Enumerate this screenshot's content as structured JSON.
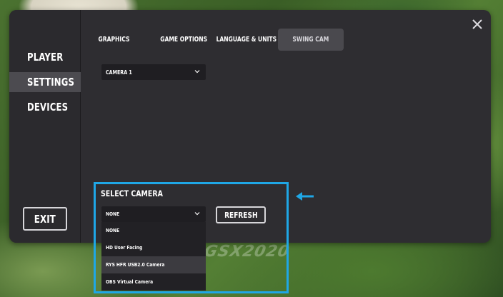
{
  "watermark": "GSX2020",
  "sidebar": {
    "items": [
      {
        "label": "PLAYER"
      },
      {
        "label": "SETTINGS"
      },
      {
        "label": "DEVICES"
      }
    ],
    "exit_label": "EXIT"
  },
  "tabs": [
    {
      "label": "GRAPHICS"
    },
    {
      "label": "GAME OPTIONS"
    },
    {
      "label": "LANGUAGE & UNITS"
    },
    {
      "label": "SWING CAM"
    }
  ],
  "active_tab": "SWING CAM",
  "camera_dropdown": {
    "value": "CAMERA 1"
  },
  "select_camera": {
    "title": "SELECT CAMERA",
    "selected": "NONE",
    "refresh_label": "REFRESH",
    "options": [
      {
        "label": "NONE"
      },
      {
        "label": "HD User Facing"
      },
      {
        "label": "RYS HFR USB2.0 Camera"
      },
      {
        "label": "OBS Virtual Camera"
      }
    ]
  },
  "colors": {
    "panel": "#2e2d31",
    "active_tab": "#4a494e",
    "highlight": "#1fa7e6",
    "active_nav": "#4c4b50"
  },
  "icons": {
    "close": "close-icon",
    "chevron": "chevron-down-icon",
    "arrow": "arrow-left-icon"
  }
}
